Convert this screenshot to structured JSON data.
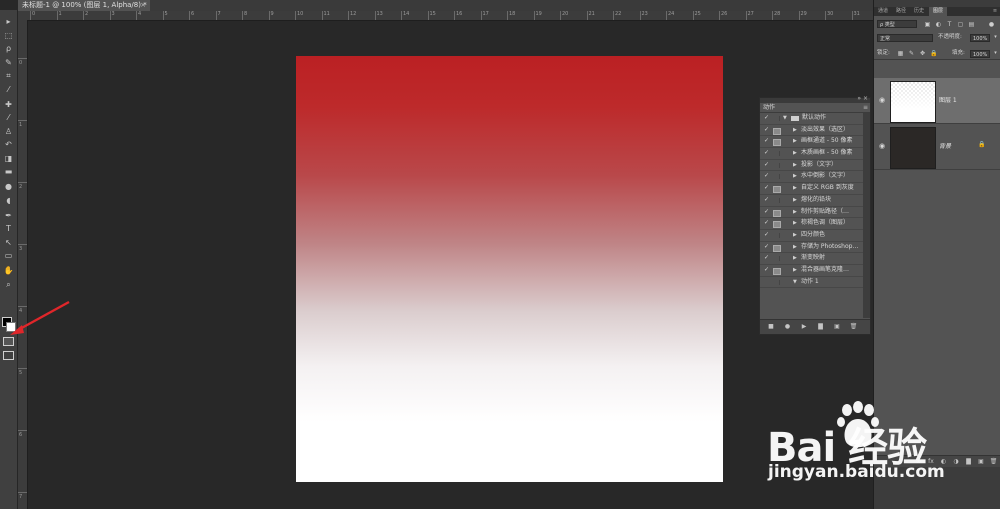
{
  "document_tab": {
    "title": "未标题-1 @ 100% (图层 1, Alpha/8) *",
    "close": "×"
  },
  "ruler_top": {
    "labels": [
      "0",
      "1",
      "2",
      "3",
      "4",
      "5",
      "6",
      "7",
      "8",
      "9",
      "10",
      "11",
      "12",
      "13",
      "14",
      "15",
      "16",
      "17",
      "18",
      "19",
      "20",
      "21",
      "22",
      "23",
      "24",
      "25",
      "26",
      "27",
      "28",
      "29",
      "30",
      "31"
    ]
  },
  "ruler_left": {
    "labels": [
      "0",
      "1",
      "2",
      "3",
      "4",
      "5",
      "6",
      "7"
    ]
  },
  "tools": {
    "items": [
      {
        "name": "move-tool",
        "glyph": "▸"
      },
      {
        "name": "marquee-tool",
        "glyph": "⬚"
      },
      {
        "name": "lasso-tool",
        "glyph": "ρ"
      },
      {
        "name": "quick-select-tool",
        "glyph": "✎"
      },
      {
        "name": "crop-tool",
        "glyph": "⌗"
      },
      {
        "name": "eyedropper-tool",
        "glyph": "⁄"
      },
      {
        "name": "healing-tool",
        "glyph": "✚"
      },
      {
        "name": "brush-tool",
        "glyph": "⁄"
      },
      {
        "name": "stamp-tool",
        "glyph": "♙"
      },
      {
        "name": "history-brush-tool",
        "glyph": "↶"
      },
      {
        "name": "eraser-tool",
        "glyph": "◨"
      },
      {
        "name": "gradient-tool",
        "glyph": "▬"
      },
      {
        "name": "blur-tool",
        "glyph": "●"
      },
      {
        "name": "dodge-tool",
        "glyph": "◖"
      },
      {
        "name": "pen-tool",
        "glyph": "✒"
      },
      {
        "name": "type-tool",
        "glyph": "T"
      },
      {
        "name": "path-select-tool",
        "glyph": "↖"
      },
      {
        "name": "shape-tool",
        "glyph": "▭"
      },
      {
        "name": "hand-tool",
        "glyph": "✋"
      },
      {
        "name": "zoom-tool",
        "glyph": "⌕"
      }
    ]
  },
  "actions_panel": {
    "tab": "动作",
    "menu": "≡",
    "rows": [
      {
        "check": "✓",
        "dialog": false,
        "tri": "▼",
        "folder": true,
        "label": "默认动作",
        "child": false
      },
      {
        "check": "✓",
        "dialog": true,
        "tri": "▶",
        "folder": false,
        "label": "淡出效果（选区）",
        "child": true
      },
      {
        "check": "✓",
        "dialog": true,
        "tri": "▶",
        "folder": false,
        "label": "画框通道 - 50 像素",
        "child": true
      },
      {
        "check": "✓",
        "dialog": false,
        "tri": "▶",
        "folder": false,
        "label": "木质画框 - 50 像素",
        "child": true
      },
      {
        "check": "✓",
        "dialog": false,
        "tri": "▶",
        "folder": false,
        "label": "投影（文字）",
        "child": true
      },
      {
        "check": "✓",
        "dialog": false,
        "tri": "▶",
        "folder": false,
        "label": "水中倒影（文字）",
        "child": true
      },
      {
        "check": "✓",
        "dialog": true,
        "tri": "▶",
        "folder": false,
        "label": "自定义 RGB 到灰度",
        "child": true
      },
      {
        "check": "✓",
        "dialog": false,
        "tri": "▶",
        "folder": false,
        "label": "熔化的铅块",
        "child": true
      },
      {
        "check": "✓",
        "dialog": true,
        "tri": "▶",
        "folder": false,
        "label": "制作剪贴路径（…",
        "child": true
      },
      {
        "check": "✓",
        "dialog": true,
        "tri": "▶",
        "folder": false,
        "label": "棕褐色调（图层）",
        "child": true
      },
      {
        "check": "✓",
        "dialog": false,
        "tri": "▶",
        "folder": false,
        "label": "四分颜色",
        "child": true
      },
      {
        "check": "✓",
        "dialog": true,
        "tri": "▶",
        "folder": false,
        "label": "存储为 Photoshop…",
        "child": true
      },
      {
        "check": "✓",
        "dialog": false,
        "tri": "▶",
        "folder": false,
        "label": "渐变映射",
        "child": true
      },
      {
        "check": "✓",
        "dialog": true,
        "tri": "▶",
        "folder": false,
        "label": "混合器画笔克隆…",
        "child": true
      },
      {
        "check": "",
        "dialog": false,
        "tri": "▼",
        "folder": false,
        "label": "动作 1",
        "child": true
      }
    ],
    "footer_buttons": [
      "■",
      "●",
      "▶",
      "▇",
      "▣",
      "🗑"
    ]
  },
  "dock": {
    "tabs": [
      "通道",
      "路径",
      "历史",
      "图层"
    ],
    "active_tab": "图层",
    "filter_label": "ρ 类型",
    "blend_mode": "正常",
    "opacity_label": "不透明度:",
    "opacity_value": "100%",
    "lock_label": "锁定:",
    "fill_label": "填充:",
    "fill_value": "100%",
    "layers": [
      {
        "name": "图层 1",
        "visible": "◉",
        "locked": ""
      },
      {
        "name": "背景",
        "visible": "◉",
        "locked": "🔒"
      }
    ],
    "footer_buttons": [
      "∞",
      "fx",
      "◐",
      "◑",
      "▇",
      "▣",
      "🗑"
    ]
  },
  "watermark": {
    "logo_text": "Bai 经验",
    "url": "jingyan.baidu.com"
  },
  "colors": {
    "canvas_top": "#bb2023",
    "canvas_bottom": "#ffffff",
    "arrow": "#e0262a"
  }
}
